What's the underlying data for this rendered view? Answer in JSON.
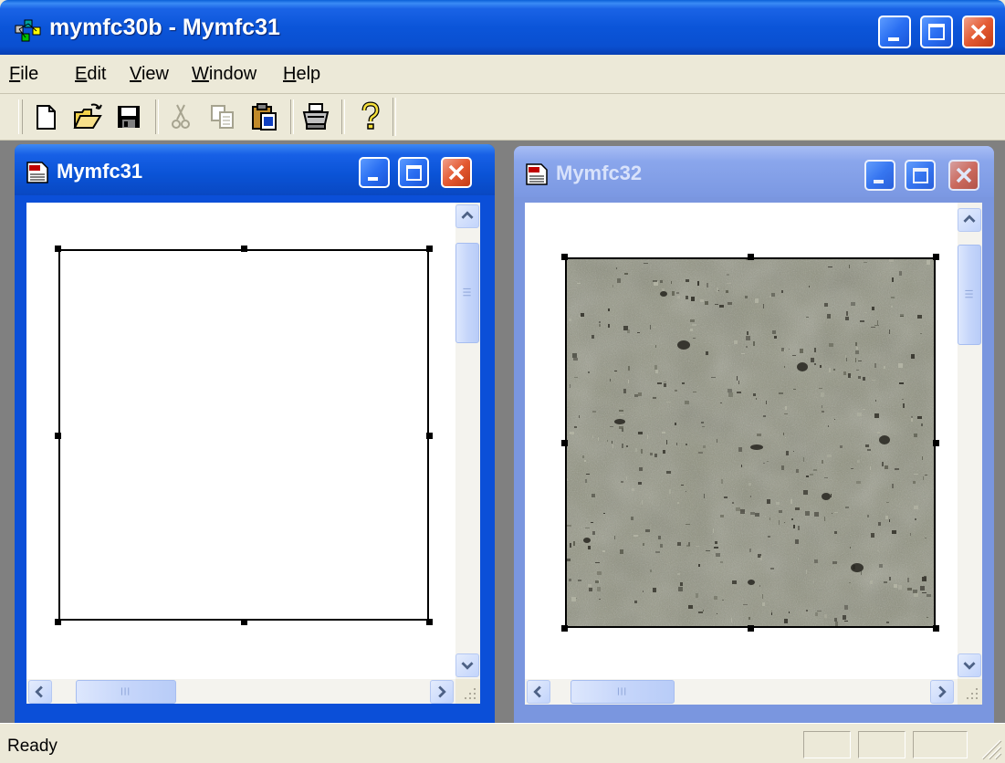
{
  "window": {
    "title": "mymfc30b - Mymfc31"
  },
  "menu": {
    "items": [
      {
        "label": "File",
        "hotkey": "F",
        "rest": "ile"
      },
      {
        "label": "Edit",
        "hotkey": "E",
        "rest": "dit"
      },
      {
        "label": "View",
        "hotkey": "V",
        "rest": "iew"
      },
      {
        "label": "Window",
        "hotkey": "W",
        "rest": "indow"
      },
      {
        "label": "Help",
        "hotkey": "H",
        "rest": "elp"
      }
    ]
  },
  "toolbar": {
    "buttons": [
      "new-icon",
      "open-icon",
      "save-icon",
      "cut-icon",
      "copy-icon",
      "paste-icon",
      "print-icon",
      "help-icon"
    ],
    "disabled": [
      "cut-icon",
      "copy-icon"
    ]
  },
  "children": {
    "left": {
      "title": "Mymfc31",
      "active": true,
      "content": "empty-frame"
    },
    "right": {
      "title": "Mymfc32",
      "active": false,
      "content": "stone-texture-image"
    }
  },
  "statusbar": {
    "text": "Ready"
  },
  "colors": {
    "active_title": "#0a53d6",
    "inactive_title": "#7b98e2",
    "close_button": "#e45a32",
    "mdi_background": "#808080",
    "chrome": "#ece9d8"
  }
}
